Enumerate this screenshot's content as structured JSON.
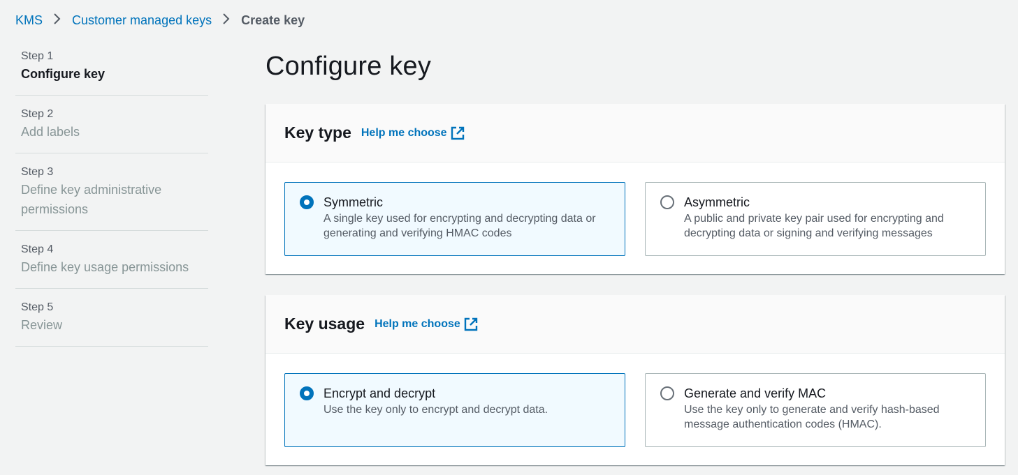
{
  "breadcrumb": {
    "items": [
      "KMS",
      "Customer managed keys"
    ],
    "current": "Create key"
  },
  "steps": [
    {
      "num": "Step 1",
      "title": "Configure key"
    },
    {
      "num": "Step 2",
      "title": "Add labels"
    },
    {
      "num": "Step 3",
      "title": "Define key administrative permissions"
    },
    {
      "num": "Step 4",
      "title": "Define key usage permissions"
    },
    {
      "num": "Step 5",
      "title": "Review"
    }
  ],
  "page_title": "Configure key",
  "key_type": {
    "title": "Key type",
    "help": "Help me choose",
    "options": [
      {
        "title": "Symmetric",
        "desc": "A single key used for encrypting and decrypting data or generating and verifying HMAC codes",
        "selected": true
      },
      {
        "title": "Asymmetric",
        "desc": "A public and private key pair used for encrypting and decrypting data or signing and verifying messages",
        "selected": false
      }
    ]
  },
  "key_usage": {
    "title": "Key usage",
    "help": "Help me choose",
    "options": [
      {
        "title": "Encrypt and decrypt",
        "desc": "Use the key only to encrypt and decrypt data.",
        "selected": true
      },
      {
        "title": "Generate and verify MAC",
        "desc": "Use the key only to generate and verify hash-based message authentication codes (HMAC).",
        "selected": false
      }
    ]
  },
  "colors": {
    "link": "#0073bb",
    "selected_bg": "#f1faff",
    "page_bg": "#f2f3f3"
  }
}
